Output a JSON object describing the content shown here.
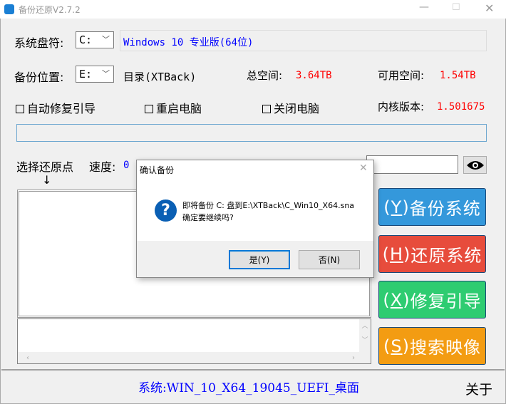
{
  "window": {
    "title": "备份还原V2.7.2"
  },
  "system_drive": {
    "label": "系统盘符:",
    "value": "C:",
    "os_info": "Windows 10 专业版(64位)"
  },
  "backup_location": {
    "label": "备份位置:",
    "value": "E:",
    "directory": "目录(XTBack)",
    "total_label": "总空间:",
    "total_value": "3.64TB",
    "free_label": "可用空间:",
    "free_value": "1.54TB"
  },
  "options": {
    "auto_repair": "自动修复引导",
    "restart": "重启电脑",
    "shutdown": "关闭电脑",
    "kernel_label": "内核版本:",
    "kernel_value": "1.501675"
  },
  "progress": {
    "percent": 0
  },
  "restore": {
    "select_label": "选择还原点",
    "arrow": "↓",
    "speed_label": "速度:",
    "speed_value": "0 B"
  },
  "buttons": {
    "backup": {
      "key": "Y",
      "label": "备份系统",
      "color": "#3498db"
    },
    "restore": {
      "key": "H",
      "label": "还原系统",
      "color": "#e74c3c"
    },
    "repair": {
      "key": "X",
      "label": "修复引导",
      "color": "#2ecc71"
    },
    "search": {
      "key": "S",
      "label": "搜索映像",
      "color": "#f39c12"
    }
  },
  "status": {
    "text": "系统:WIN_10_X64_19045_UEFI_桌面",
    "about": "关于"
  },
  "dialog": {
    "title": "确认备份",
    "line1": "即将备份 C: 盘到E:\\XTBack\\C_Win10_X64.sna",
    "line2": "确定要继续吗?",
    "yes": "是(Y)",
    "no": "否(N)"
  }
}
